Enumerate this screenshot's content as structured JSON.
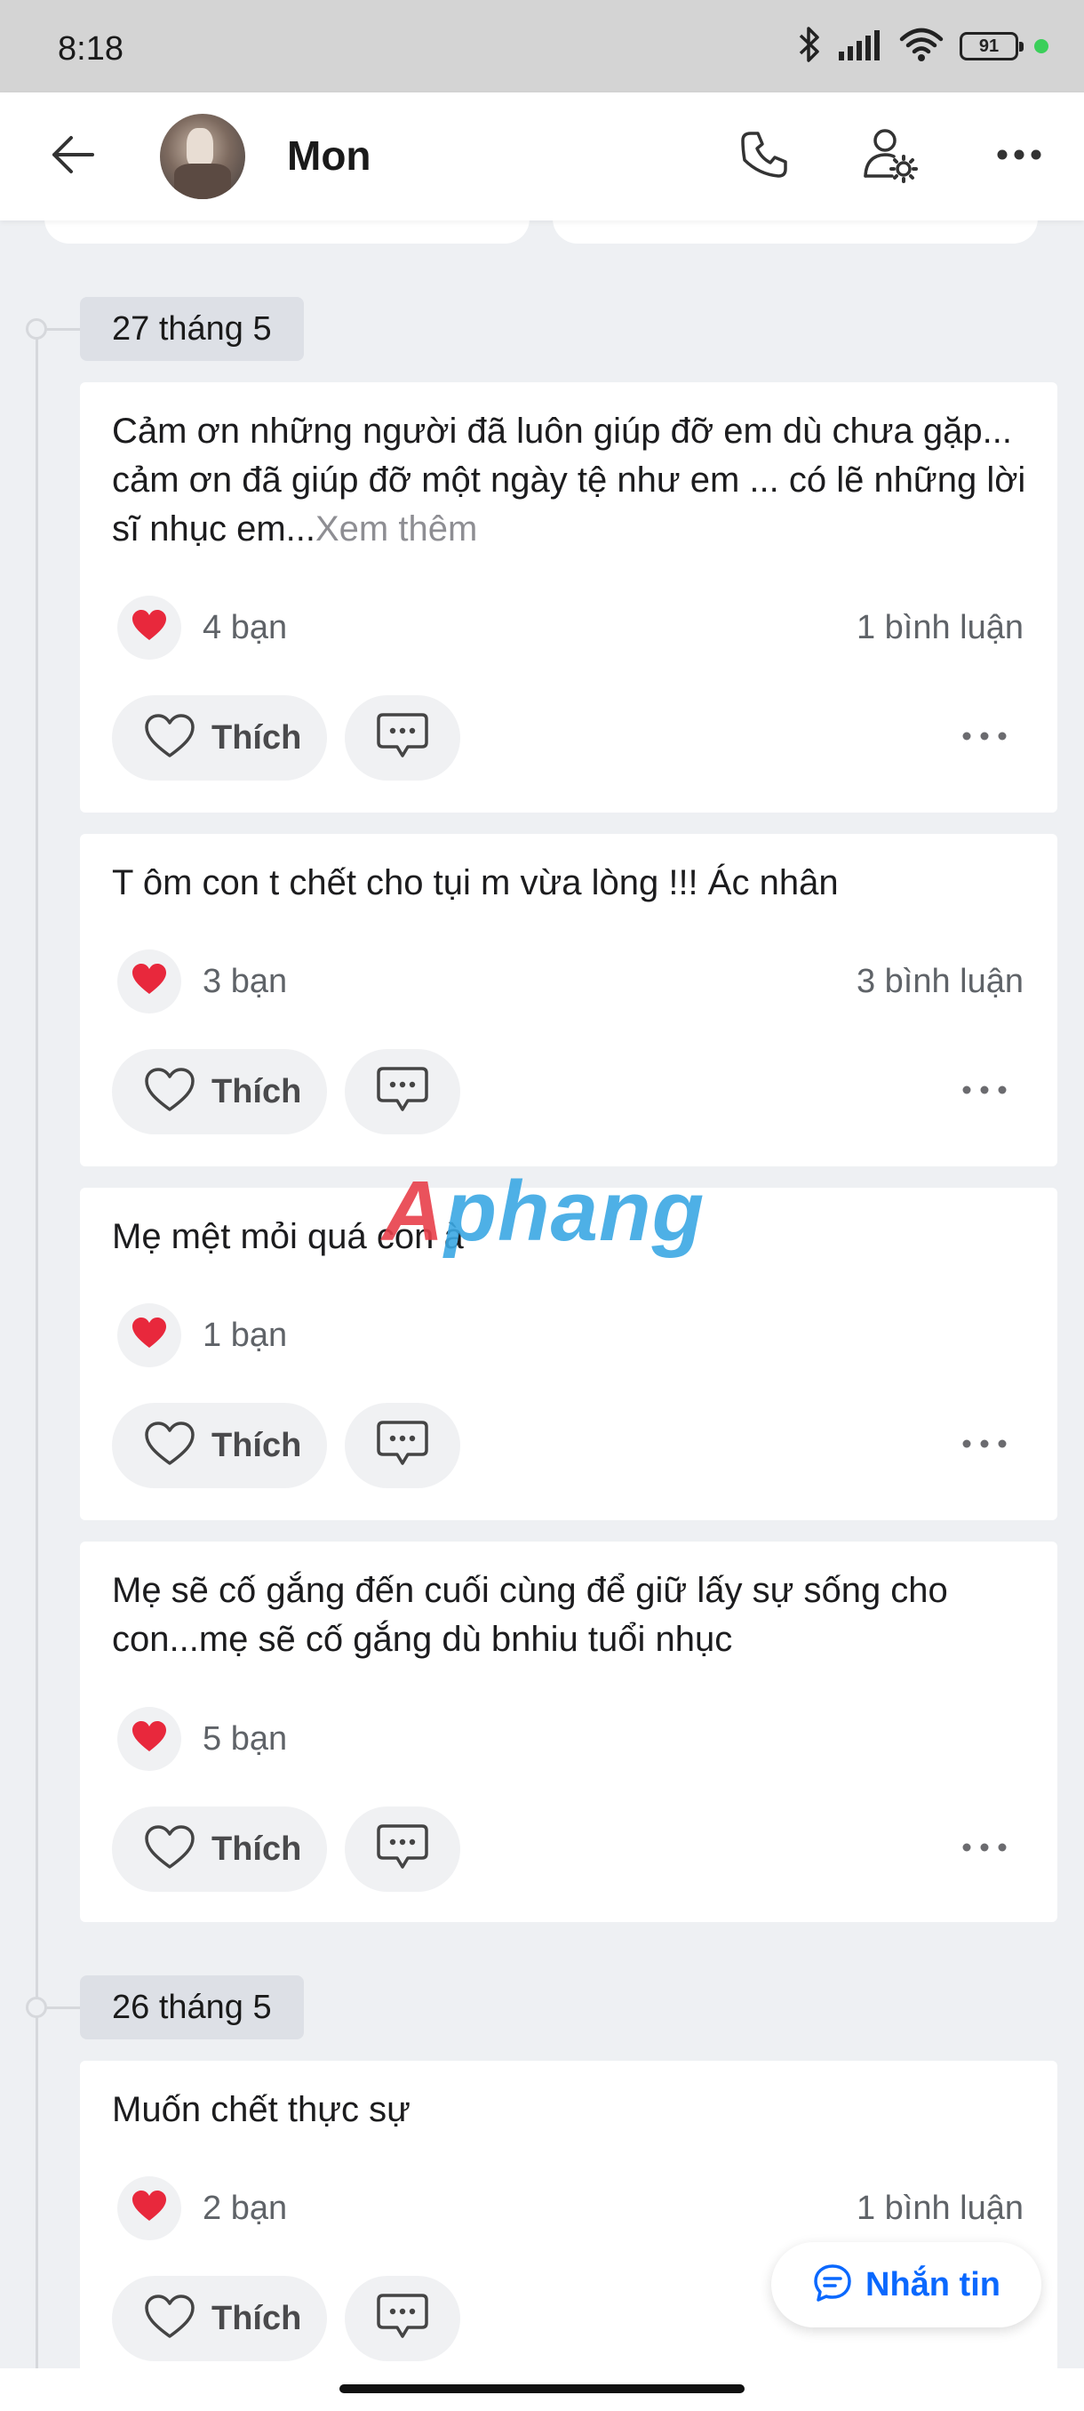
{
  "status_bar": {
    "time": "8:18",
    "battery": "91",
    "icons": [
      "bluetooth-icon",
      "signal-icon",
      "wifi-icon",
      "battery-icon"
    ]
  },
  "header": {
    "contact_name": "Mon",
    "icons": [
      "back-arrow-icon",
      "phone-icon",
      "user-settings-icon",
      "more-icon"
    ]
  },
  "timeline": [
    {
      "date": "27 tháng 5",
      "posts": [
        {
          "text": "Cảm ơn những người đã luôn giúp đỡ em dù chưa gặp... cảm ơn đã giúp đỡ một ngày tệ như em ... có lẽ những lời sĩ nhục em...",
          "see_more": "Xem thêm",
          "reactions": "4 bạn",
          "comments": "1 bình luận",
          "like_label": "Thích"
        },
        {
          "text": "T ôm con t chết cho tụi m vừa lòng !!! Ác nhân",
          "reactions": "3 bạn",
          "comments": "3 bình luận",
          "like_label": "Thích"
        },
        {
          "text": "Mẹ mệt mỏi quá con à",
          "reactions": "1 bạn",
          "comments": "",
          "like_label": "Thích"
        },
        {
          "text": "Mẹ sẽ cố gắng đến cuối cùng để giữ lấy sự sống cho con...mẹ sẽ cố gắng dù bnhiu tuổi nhục",
          "reactions": "5 bạn",
          "comments": "",
          "like_label": "Thích"
        }
      ]
    },
    {
      "date": "26 tháng 5",
      "posts": [
        {
          "text": "Muốn chết thực sự",
          "reactions": "2 bạn",
          "comments": "1 bình luận",
          "like_label": "Thích"
        }
      ]
    }
  ],
  "watermark": {
    "part1": "A",
    "part2": "phang"
  },
  "message_button": {
    "label": "Nhắn tin"
  },
  "colors": {
    "accent": "#0a68fe",
    "heart": "#e8283c",
    "background": "#eef0f3",
    "card": "#ffffff"
  }
}
